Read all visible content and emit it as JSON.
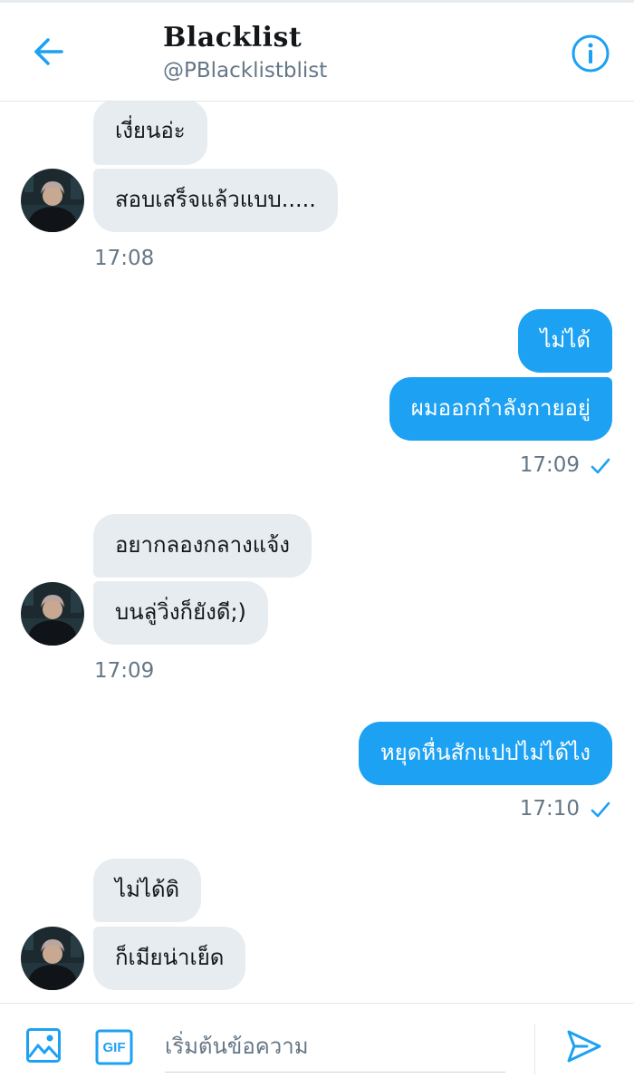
{
  "header": {
    "title": "Blacklist",
    "handle": "@PBlacklistblist",
    "back_icon": "arrow-left-icon",
    "info_icon": "info-icon"
  },
  "messages": {
    "group1": {
      "m1": "เงี่ยนอ่ะ",
      "m2": "สอบเสร็จแล้วแบบ.....",
      "time": "17:08"
    },
    "group2": {
      "m1": "ไม่ได้",
      "m2": "ผมออกกำลังกายอยู่",
      "time": "17:09"
    },
    "group3": {
      "m1": "อยากลองกลางแจ้ง",
      "m2": "บนลู่วิ่งก็ยังดี;)",
      "time": "17:09"
    },
    "group4": {
      "m1": "หยุดหื่นสักแปปไม่ได้ไง",
      "time": "17:10"
    },
    "group5": {
      "m1": "ไม่ได้ดิ",
      "m2": "ก็เมียน่าเย็ด"
    }
  },
  "composer": {
    "placeholder": "เริ่มต้นข้อความ",
    "gif_label": "GIF",
    "media_icon": "image-icon",
    "send_icon": "send-icon"
  },
  "colors": {
    "accent": "#1da1f2",
    "incoming_bubble": "#e6ecf0",
    "secondary_text": "#657786"
  }
}
